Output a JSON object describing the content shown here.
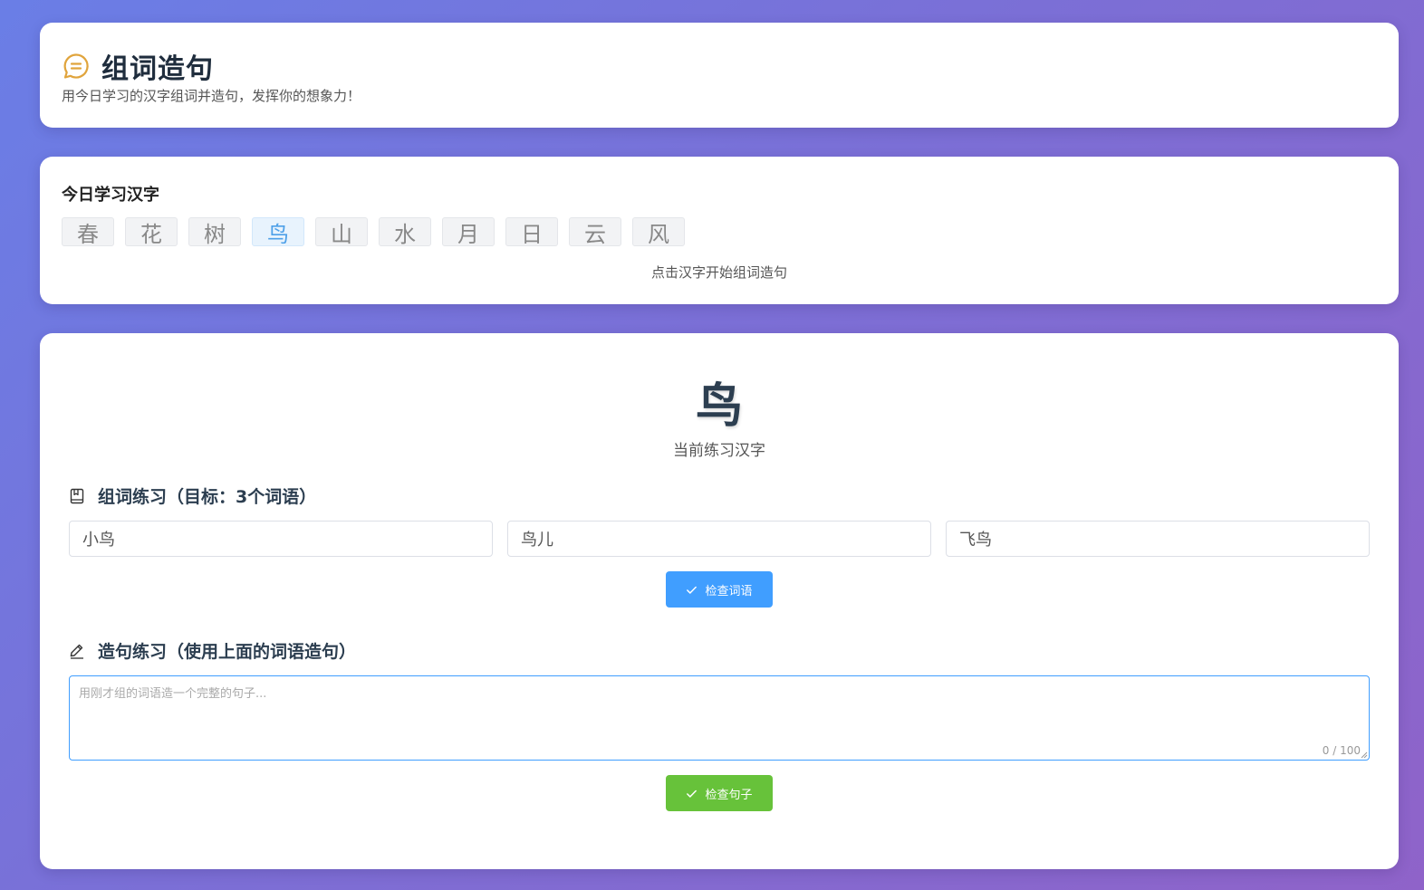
{
  "header": {
    "title": "组词造句",
    "subtitle": "用今日学习的汉字组词并造句，发挥你的想象力！"
  },
  "today": {
    "heading": "今日学习汉字",
    "chars": [
      "春",
      "花",
      "树",
      "鸟",
      "山",
      "水",
      "月",
      "日",
      "云",
      "风"
    ],
    "selected_index": 3,
    "hint": "点击汉字开始组词造句"
  },
  "practice": {
    "current_char": "鸟",
    "current_caption": "当前练习汉字",
    "words_section": {
      "title": "组词练习（目标：3个词语）",
      "words": [
        "小鸟",
        "鸟儿",
        "飞鸟"
      ],
      "check_label": "检查词语"
    },
    "sentence_section": {
      "title": "造句练习（使用上面的词语造句）",
      "placeholder": "用刚才组的词语造一个完整的句子...",
      "value": "",
      "count": "0 / 100",
      "check_label": "检查句子"
    }
  },
  "colors": {
    "primary": "#409eff",
    "success": "#67c23a",
    "accent": "#e6a23c"
  }
}
